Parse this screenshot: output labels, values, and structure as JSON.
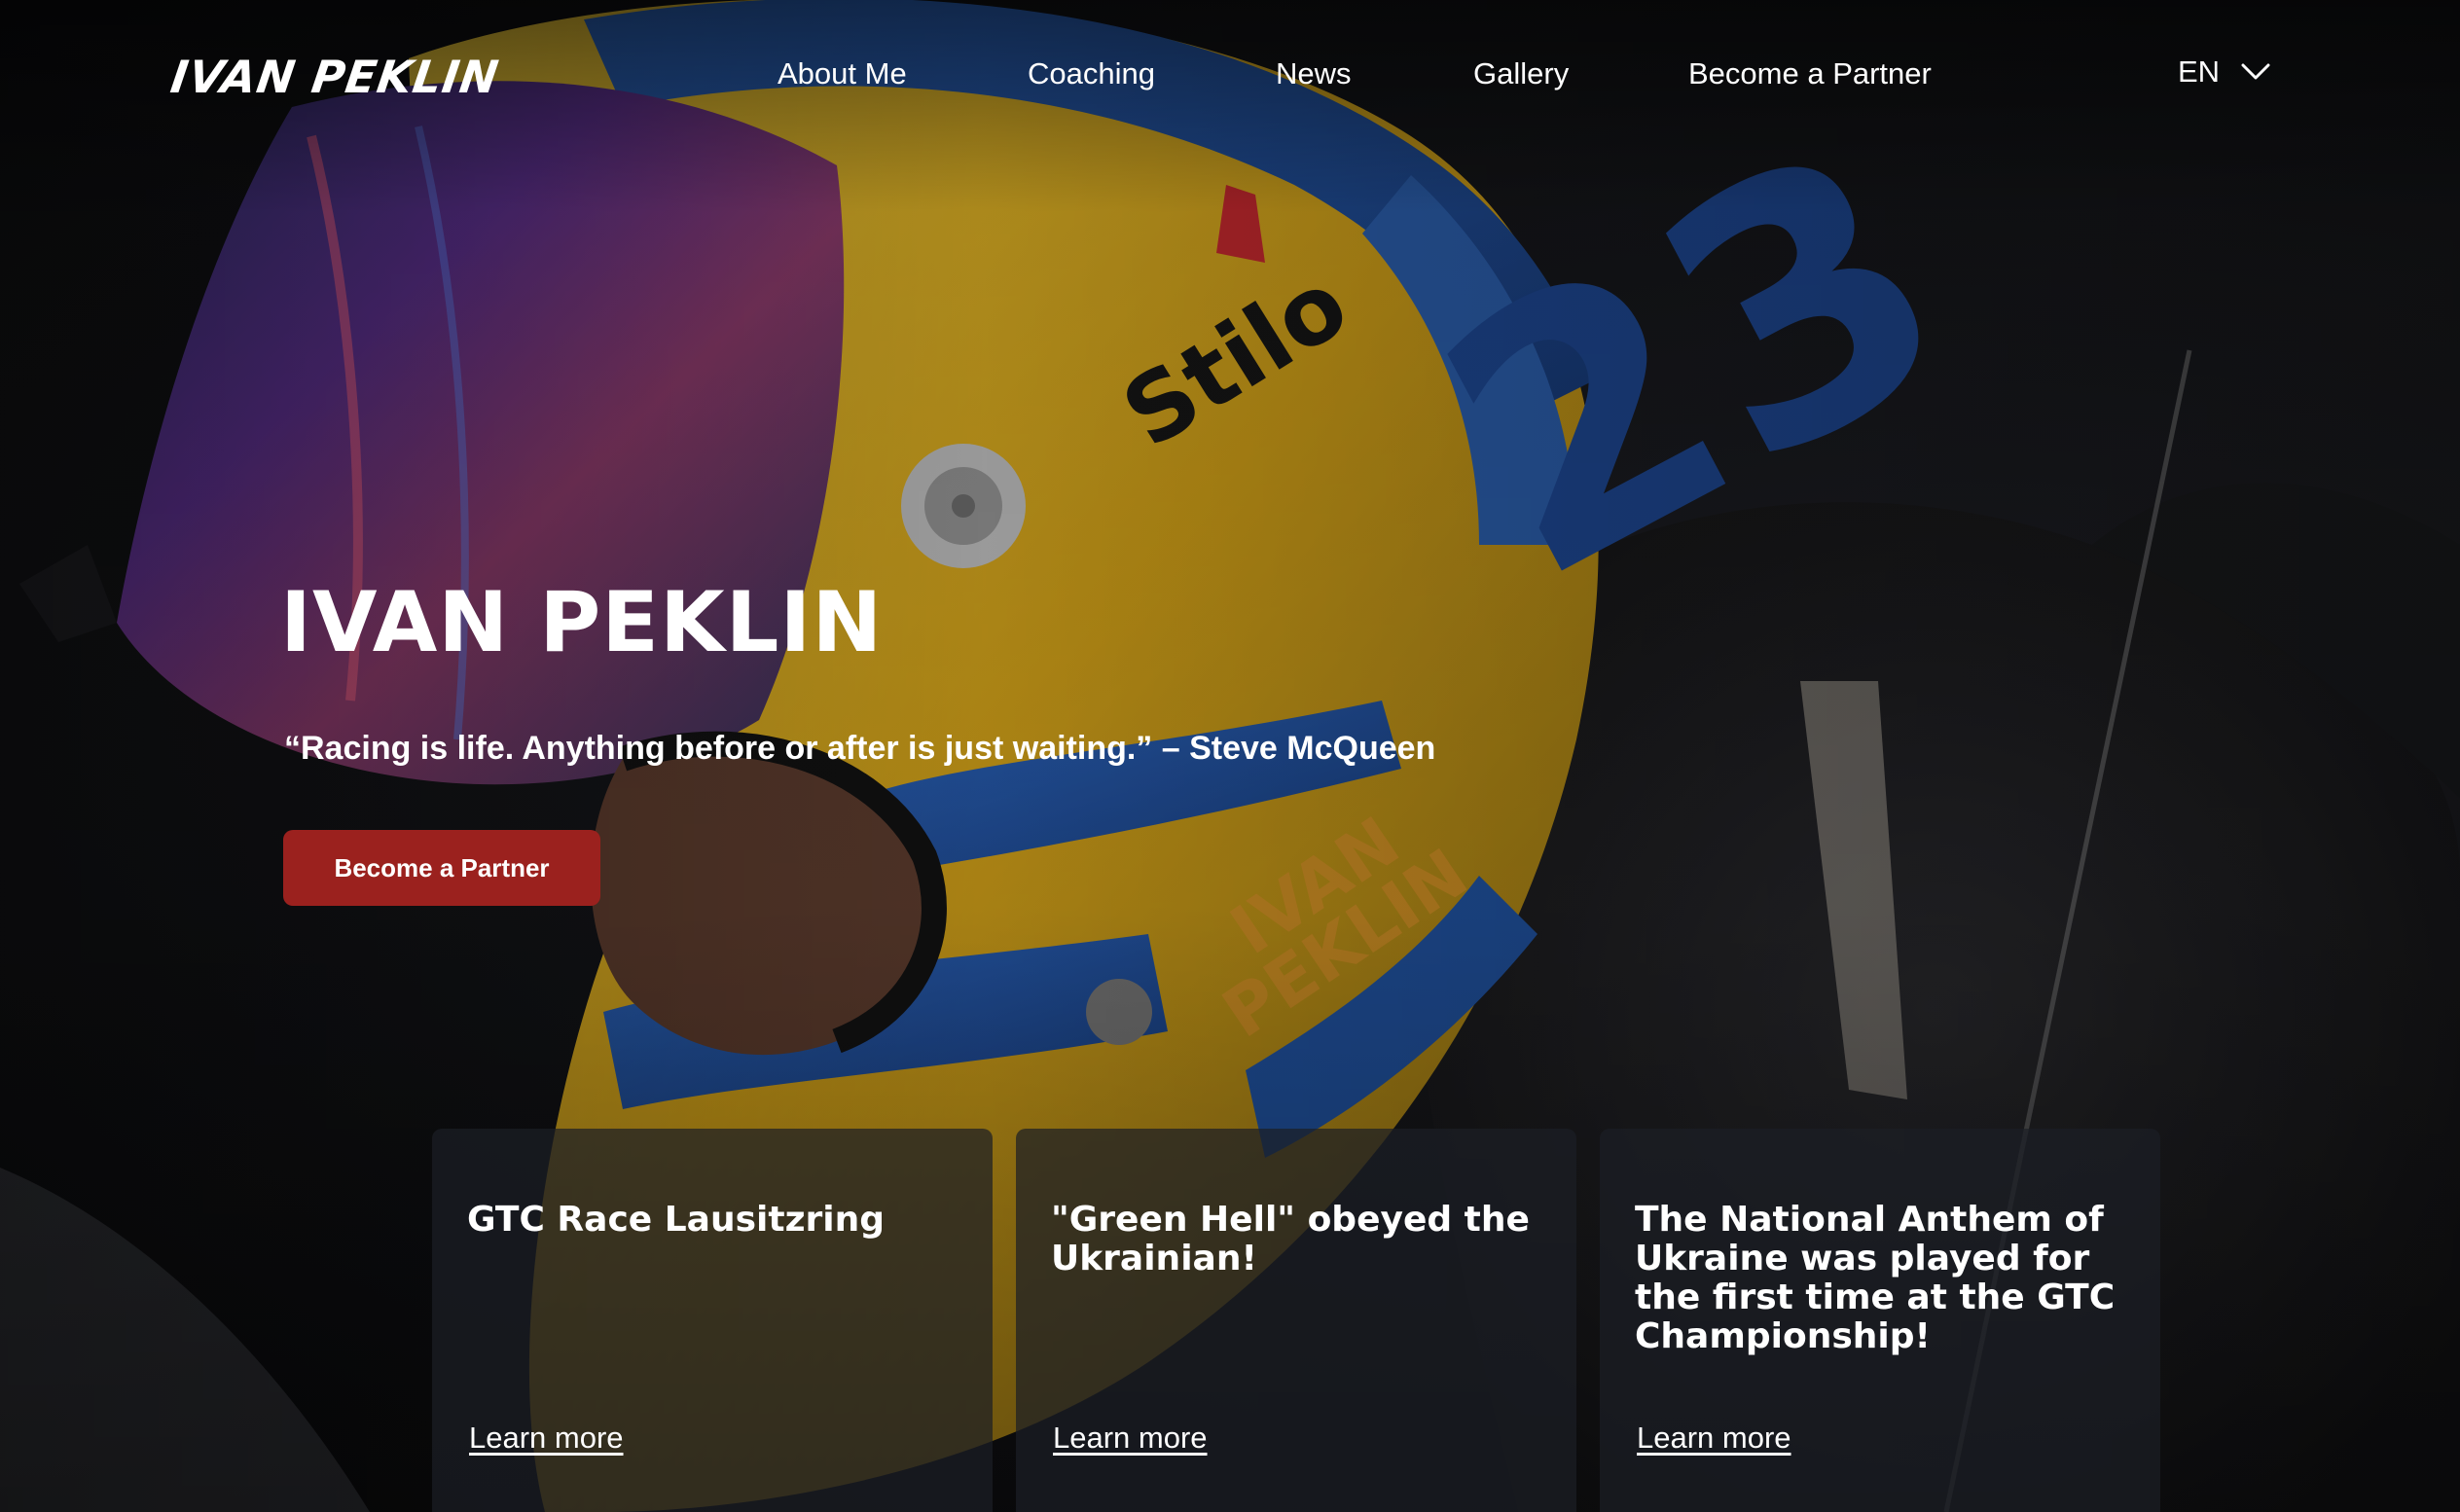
{
  "brand": {
    "logo_text": "IVAN PEKLIN"
  },
  "nav": {
    "items": [
      {
        "label": "About Me"
      },
      {
        "label": "Coaching"
      },
      {
        "label": "News"
      },
      {
        "label": "Gallery"
      },
      {
        "label": "Become a Partner"
      }
    ]
  },
  "language": {
    "current": "EN",
    "icon": "chevron-down-icon"
  },
  "hero": {
    "title": "IVAN PEKLIN",
    "quote": "“Racing is life. Anything before or after is just waiting.” – Steve McQueen",
    "cta_label": "Become a Partner",
    "cta_color": "#9b211e"
  },
  "news": {
    "cards": [
      {
        "title": "GTC Race Lausitzring",
        "link_label": "Learn more"
      },
      {
        "title": "\"Green Hell\" obeyed the Ukrainian!",
        "link_label": "Learn more"
      },
      {
        "title": "The National Anthem of Ukraine was played for the first time at the GTC Championship!",
        "link_label": "Learn more"
      }
    ]
  },
  "colors": {
    "helmet_yellow": "#d9b01f",
    "helmet_blue": "#1f4f9a",
    "background": "#0d0d0f"
  }
}
